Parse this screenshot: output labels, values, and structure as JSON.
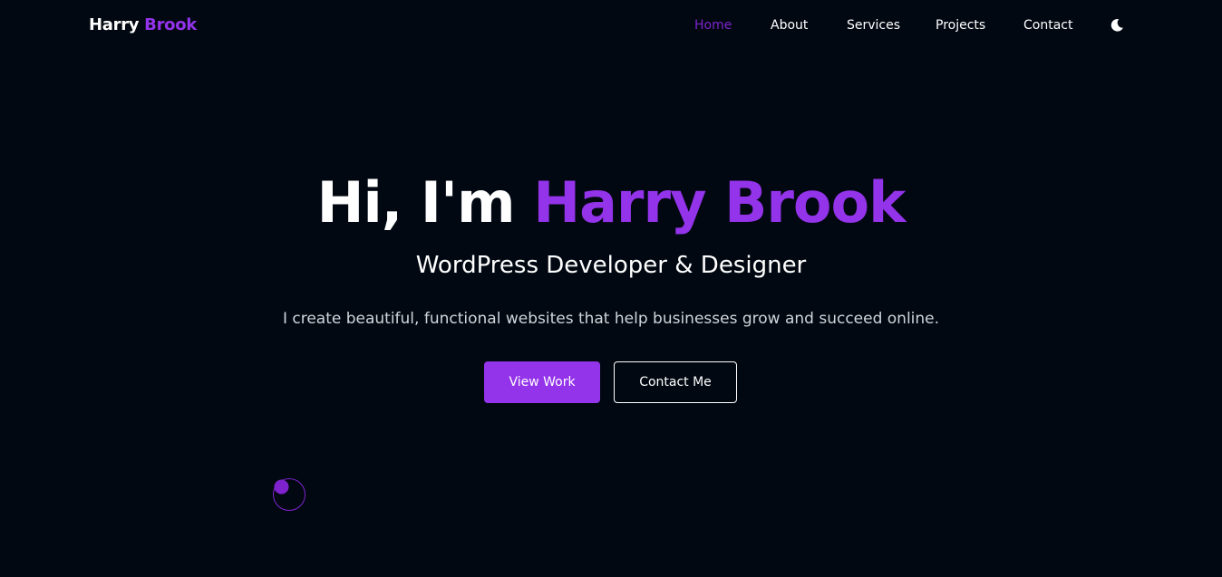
{
  "header": {
    "logo_first": "Harry",
    "logo_last": "Brook",
    "nav": {
      "home": "Home",
      "about": "About",
      "services": "Services",
      "projects": "Projects",
      "contact": "Contact"
    },
    "active_item": "Home",
    "theme_toggle_icon": "moon-icon"
  },
  "hero": {
    "greeting": "Hi, I'm",
    "name": "Harry Brook",
    "subtitle": "WordPress Developer & Designer",
    "description": "I create beautiful, functional websites that help businesses grow and succeed online.",
    "primary_button": "View Work",
    "secondary_button": "Contact Me"
  },
  "colors": {
    "background": "#020812",
    "accent": "#9333ea",
    "active_nav": "#7e22ce",
    "text": "#ffffff",
    "muted_text": "#d1d5db"
  }
}
